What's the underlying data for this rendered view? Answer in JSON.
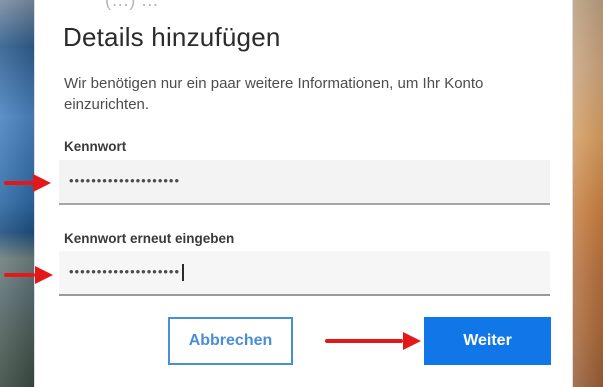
{
  "dialog": {
    "top_text": "(…) …",
    "title": "Details hinzufügen",
    "subtitle": "Wir benötigen nur ein paar weitere Informationen, um Ihr Konto einzurichten."
  },
  "fields": {
    "password": {
      "label": "Kennwort",
      "value": "••••••••••••••••••••"
    },
    "password_repeat": {
      "label": "Kennwort erneut eingeben",
      "value": "••••••••••••••••••••"
    }
  },
  "buttons": {
    "cancel": "Abbrechen",
    "next": "Weiter"
  },
  "annotations": {
    "arrow_color": "#e31818",
    "accent_blue": "#1177e8"
  }
}
